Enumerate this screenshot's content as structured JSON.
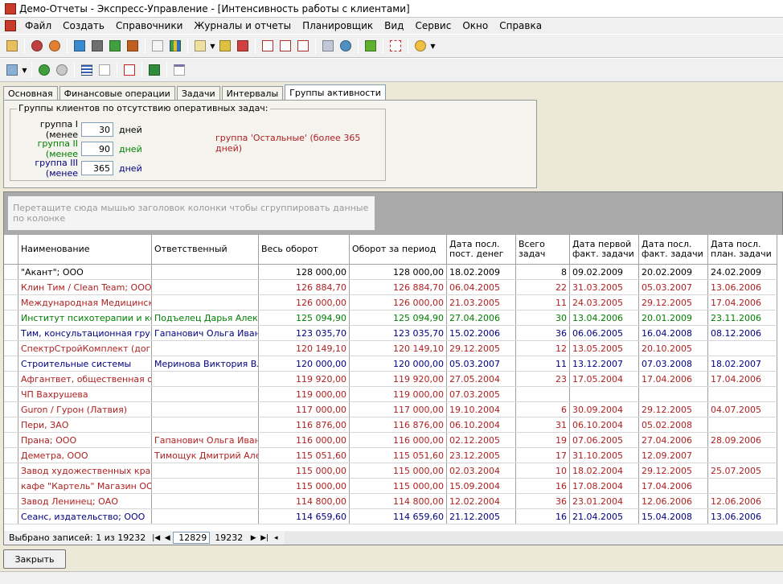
{
  "window": {
    "title": "Демо-Отчеты - Экспресс-Управление - [Интенсивность работы с клиентами]"
  },
  "menu": [
    "Файл",
    "Создать",
    "Справочники",
    "Журналы и отчеты",
    "Планировщик",
    "Вид",
    "Сервис",
    "Окно",
    "Справка"
  ],
  "tabs": [
    "Основная",
    "Финансовые операции",
    "Задачи",
    "Интервалы",
    "Группы активности"
  ],
  "groups": {
    "legend": "Группы клиентов по отсутствию оперативных задач:",
    "rows": [
      {
        "label": "группа I (менее",
        "value": "30",
        "unit": "дней",
        "color": "#000000"
      },
      {
        "label": "группа II (менее",
        "value": "90",
        "unit": "дней",
        "color": "#008000"
      },
      {
        "label": "группа III (менее",
        "value": "365",
        "unit": "дней",
        "color": "#000080"
      }
    ],
    "other": "группа 'Остальные' (более 365 дней)"
  },
  "group_hint": "Перетащите сюда мышью заголовок колонки чтобы сгруппировать данные по колонке",
  "columns": [
    "Наименование",
    "Ответственный",
    "Весь оборот",
    "Оборот за период",
    "Дата посл. пост. денег",
    "Всего задач",
    "Дата первой факт. задачи",
    "Дата посл. факт. задачи",
    "Дата посл. план. задачи"
  ],
  "colors": {
    "g1": "#000000",
    "g2": "#008000",
    "g3": "#000080",
    "other": "#b02020"
  },
  "rows": [
    {
      "g": "g1",
      "c": [
        "\"Акант\"; ООО",
        "",
        "128 000,00",
        "128 000,00",
        "18.02.2009",
        "8",
        "09.02.2009",
        "20.02.2009",
        "24.02.2009"
      ]
    },
    {
      "g": "other",
      "c": [
        "Клин Тим / Clean Team; ООО",
        "",
        "126 884,70",
        "126 884,70",
        "06.04.2005",
        "22",
        "31.03.2005",
        "05.03.2007",
        "13.06.2006"
      ]
    },
    {
      "g": "other",
      "c": [
        "Международная Медицинска...",
        "",
        "126 000,00",
        "126 000,00",
        "21.03.2005",
        "11",
        "24.03.2005",
        "29.12.2005",
        "17.04.2006"
      ]
    },
    {
      "g": "g2",
      "c": [
        "Институт психотерапии и кон...",
        "Подъелец Дарья Алек...",
        "125 094,90",
        "125 094,90",
        "27.04.2006",
        "30",
        "13.04.2006",
        "20.01.2009",
        "23.11.2006"
      ]
    },
    {
      "g": "g3",
      "c": [
        "Тим, консультационная группа",
        "Гапанович Ольга Иван...",
        "123 035,70",
        "123 035,70",
        "15.02.2006",
        "36",
        "06.06.2005",
        "16.04.2008",
        "08.12.2006"
      ]
    },
    {
      "g": "other",
      "c": [
        "СпектрСтройКомплект (догов...",
        "",
        "120 149,10",
        "120 149,10",
        "29.12.2005",
        "12",
        "13.05.2005",
        "20.10.2005",
        ""
      ]
    },
    {
      "g": "g3",
      "c": [
        "Строительные системы",
        "Меринова Виктория Вл...",
        "120 000,00",
        "120 000,00",
        "05.03.2007",
        "11",
        "13.12.2007",
        "07.03.2008",
        "18.02.2007"
      ]
    },
    {
      "g": "other",
      "c": [
        "Афгантвет, общественная орг...",
        "",
        "119 920,00",
        "119 920,00",
        "27.05.2004",
        "23",
        "17.05.2004",
        "17.04.2006",
        "17.04.2006"
      ]
    },
    {
      "g": "other",
      "c": [
        "ЧП Вахрушева",
        "",
        "119 000,00",
        "119 000,00",
        "07.03.2005",
        "",
        "",
        "",
        ""
      ]
    },
    {
      "g": "other",
      "c": [
        "Guron / Гурон (Латвия)",
        "",
        "117 000,00",
        "117 000,00",
        "19.10.2004",
        "6",
        "30.09.2004",
        "29.12.2005",
        "04.07.2005"
      ]
    },
    {
      "g": "other",
      "c": [
        "Пери, ЗАО",
        "",
        "116 876,00",
        "116 876,00",
        "06.10.2004",
        "31",
        "06.10.2004",
        "05.02.2008",
        ""
      ]
    },
    {
      "g": "other",
      "c": [
        "Прана; ООО",
        "Гапанович Ольга Иван...",
        "116 000,00",
        "116 000,00",
        "02.12.2005",
        "19",
        "07.06.2005",
        "27.04.2006",
        "28.09.2006"
      ]
    },
    {
      "g": "other",
      "c": [
        "Деметра, ООО",
        "Тимощук Дмитрий Але...",
        "115 051,60",
        "115 051,60",
        "23.12.2005",
        "17",
        "31.10.2005",
        "12.09.2007",
        ""
      ]
    },
    {
      "g": "other",
      "c": [
        "Завод художественных красо...",
        "",
        "115 000,00",
        "115 000,00",
        "02.03.2004",
        "10",
        "18.02.2004",
        "29.12.2005",
        "25.07.2005"
      ]
    },
    {
      "g": "other",
      "c": [
        "кафе \"Картель\" Магазин ОО...",
        "",
        "115 000,00",
        "115 000,00",
        "15.09.2004",
        "16",
        "17.08.2004",
        "17.04.2006",
        ""
      ]
    },
    {
      "g": "other",
      "c": [
        "Завод Ленинец; ОАО",
        "",
        "114 800,00",
        "114 800,00",
        "12.02.2004",
        "36",
        "23.01.2004",
        "12.06.2006",
        "12.06.2006"
      ]
    },
    {
      "g": "g3",
      "c": [
        "Сеанс, издательство; ООО",
        "",
        "114 659,60",
        "114 659,60",
        "21.12.2005",
        "16",
        "21.04.2005",
        "15.04.2008",
        "13.06.2006"
      ]
    }
  ],
  "status": {
    "selected": "Выбрано записей: 1 из 19232",
    "current": "12829",
    "total": "19232"
  },
  "close_label": "Закрыть"
}
